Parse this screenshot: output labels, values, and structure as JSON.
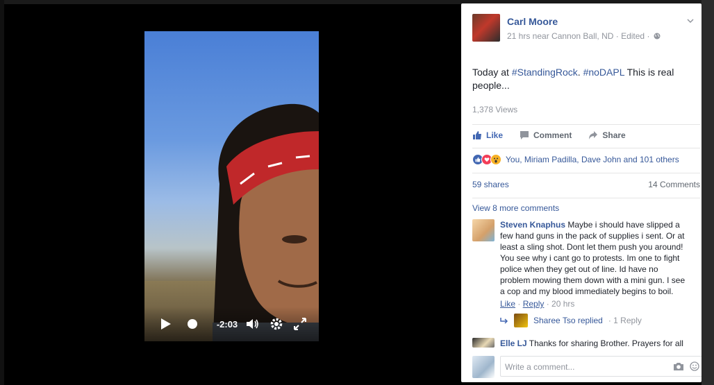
{
  "video": {
    "time_remaining": "-2:03"
  },
  "post": {
    "author": "Carl Moore",
    "meta": "21 hrs near Cannon Ball, ND · Edited ·",
    "text_prefix": "Today at ",
    "hashtag1": "#StandingRock",
    "text_mid": ". ",
    "hashtag2": "#noDAPL",
    "text_suffix": " This is real people...",
    "views": "1,378 Views"
  },
  "actions": {
    "like": "Like",
    "comment": "Comment",
    "share": "Share"
  },
  "reactions": {
    "summary": "You, Miriam Padilla, Dave John and 101 others"
  },
  "stats": {
    "shares": "59 shares",
    "comments": "14 Comments"
  },
  "comments": {
    "view_more": "View 8 more comments",
    "items": [
      {
        "name": "Steven Knaphus",
        "text": " Maybe i should have slipped a few hand guns in the pack of supplies i sent. Or at least a sling shot. Dont let them push you around! You see why i cant go to protests. Im one to fight police when they get out of line. Id have no problem mowing them down with a mini gun. I see a cop and my blood immediately begins to boil.",
        "like": "Like",
        "reply": "Reply",
        "time": "· 20 hrs"
      },
      {
        "name": "Elle LJ",
        "text": " Thanks for sharing Brother. Prayers for all"
      }
    ],
    "reply_summary": "Sharee Tso replied",
    "reply_count": "· 1 Reply"
  },
  "composer": {
    "placeholder": "Write a comment..."
  },
  "colors": {
    "link": "#365899",
    "like_blue": "#4267b2",
    "muted": "#90949c"
  }
}
